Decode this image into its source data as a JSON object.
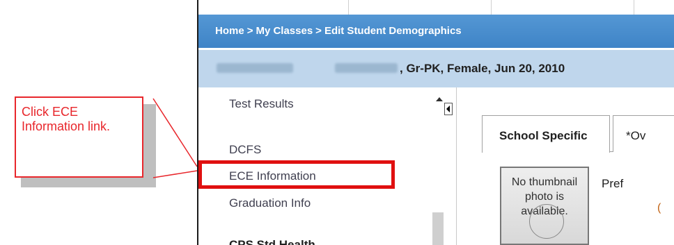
{
  "callout": {
    "text": "Click ECE Information link."
  },
  "breadcrumb": {
    "home": "Home",
    "separator": ">",
    "my_classes": "My Classes",
    "current": "Edit Student Demographics"
  },
  "student_info": {
    "details": ", Gr-PK, Female, Jun 20, 2010"
  },
  "sidebar": {
    "items": [
      {
        "label": "Test Results"
      },
      {
        "label": "DCFS"
      },
      {
        "label": "ECE Information"
      },
      {
        "label": "Graduation Info"
      },
      {
        "label": "CPS Std Health"
      }
    ]
  },
  "tabs": [
    {
      "label": "School Specific"
    },
    {
      "label": "*Ov"
    }
  ],
  "photo": {
    "placeholder": "No thumbnail photo is available."
  },
  "preferred": {
    "label": "Pref",
    "char": "("
  },
  "colors": {
    "accent": "#e8262b",
    "header_blue": "#4a8ecf",
    "info_bar": "#bfd6ec"
  }
}
